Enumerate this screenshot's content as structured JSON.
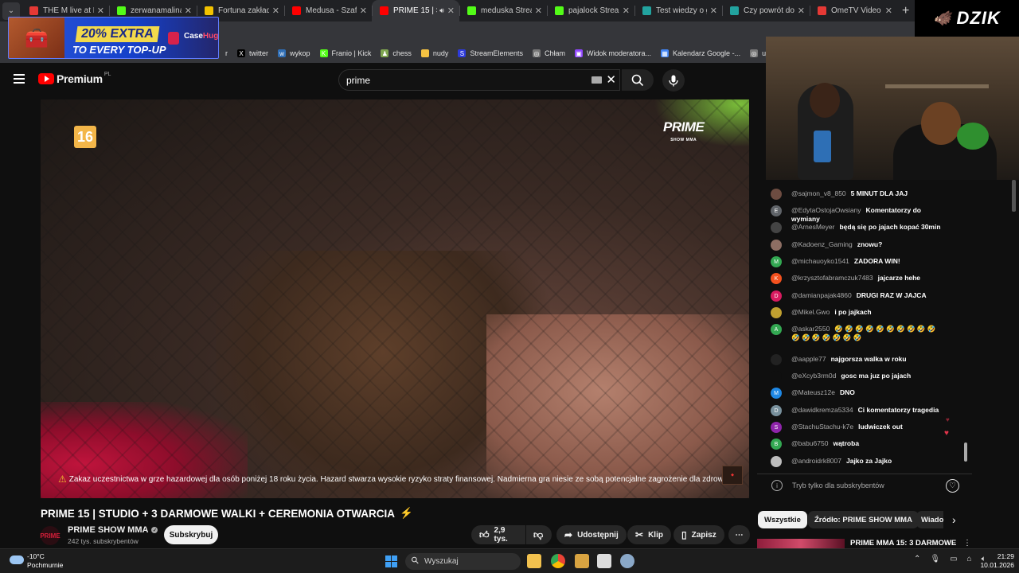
{
  "browser": {
    "tabs": [
      {
        "title": "THE M live at FESTI",
        "color": "#e53935",
        "active": false
      },
      {
        "title": "zerwanamalina Str",
        "color": "#53fc18",
        "active": false
      },
      {
        "title": "Fortuna zakłady b",
        "color": "#f2c200",
        "active": false
      },
      {
        "title": "Medusa - Szafa (p",
        "color": "#ff0000",
        "active": false
      },
      {
        "title": "PRIME 15 | STU",
        "color": "#ff0000",
        "active": true
      },
      {
        "title": "meduska Strea",
        "color": "#53fc18",
        "active": false
      },
      {
        "title": "pajalock Stream -",
        "color": "#53fc18",
        "active": false
      },
      {
        "title": "Test wiedzy o gru",
        "color": "#22a39f",
        "active": false
      },
      {
        "title": "Czy powrót do sz",
        "color": "#22a39f",
        "active": false
      },
      {
        "title": "OmeTV Video Ch",
        "color": "#e53935",
        "active": false
      }
    ],
    "bookmarks": [
      {
        "label": "r",
        "icon": "",
        "color": "#35363a"
      },
      {
        "label": "twitter",
        "icon": "X",
        "color": "#000000"
      },
      {
        "label": "wykop",
        "icon": "w",
        "color": "#2f6eb5"
      },
      {
        "label": "Franio | Kick",
        "icon": "K",
        "color": "#53fc18"
      },
      {
        "label": "chess",
        "icon": "♟",
        "color": "#7fa650"
      },
      {
        "label": "nudy",
        "icon": "",
        "color": "#f5c242"
      },
      {
        "label": "StreamElements",
        "icon": "S",
        "color": "#2e3bdb"
      },
      {
        "label": "Chłam",
        "icon": "◎",
        "color": "#777777"
      },
      {
        "label": "Widok moderatora...",
        "icon": "▣",
        "color": "#9146ff"
      },
      {
        "label": "Kalendarz Google -...",
        "icon": "▦",
        "color": "#4285f4"
      },
      {
        "label": "ujeb link",
        "icon": "◎",
        "color": "#777777"
      },
      {
        "label": "be",
        "icon": "▬",
        "color": "#e53935"
      }
    ]
  },
  "overlay": {
    "ad_line1": "20% EXTRA",
    "ad_line2": "TO EVERY TOP-UP",
    "ad_brand_a": "Case",
    "ad_brand_b": "Hug",
    "dzik": "DZIK"
  },
  "header": {
    "logo_text": "Premium",
    "logo_region": "PL",
    "search_value": "prime"
  },
  "video": {
    "age_rating": "16",
    "channel_logo_main": "PRIME",
    "channel_logo_sub": "SHOW MMA",
    "warning": "Zakaz uczestnictwa w grze hazardowej dla osób poniżej 18 roku życia. Hazard stwarza wysokie ryzyko straty finansowej. Nadmierna gra niesie ze sobą potencjalne zagrożenie dla zdrowia",
    "title": "PRIME 15 | STUDIO + 3 DARMOWE WALKI + CEREMONIA OTWARCIA",
    "channel": "PRIME SHOW MMA",
    "subscribers": "242 tys. subskrybentów",
    "subscribe_label": "Subskrybuj",
    "likes": "2,9 tys.",
    "share_label": "Udostępnij",
    "clip_label": "Klip",
    "save_label": "Zapisz"
  },
  "chat": {
    "messages": [
      {
        "author": "@sajmon_v8_850",
        "text": "5 MINUT DLA JAJ",
        "initial": "",
        "color": "#6d4c41"
      },
      {
        "author": "@EdytaOstojaOwsiany",
        "text": "Komentatorzy do wymiany",
        "initial": "E",
        "color": "#5f6368"
      },
      {
        "author": "@ArnesMeyer",
        "text": "będą się po jajach kopać 30min",
        "initial": "",
        "color": "#444444"
      },
      {
        "author": "@Kadoenz_Gaming",
        "text": "znowu?",
        "initial": "",
        "color": "#8d6e63"
      },
      {
        "author": "@michauoyko1541",
        "text": "ZADORA WIN!",
        "initial": "M",
        "color": "#33a852"
      },
      {
        "author": "@krzysztofabramczuk7483",
        "text": "jajcarze hehe",
        "initial": "K",
        "color": "#f4511e"
      },
      {
        "author": "@damianpajak4860",
        "text": "DRUGI RAZ W JAJCA",
        "initial": "D",
        "color": "#d81b60"
      },
      {
        "author": "@Mikel.Gwo",
        "text": "i po jajkach",
        "initial": "",
        "color": "#c0a030"
      },
      {
        "author": "@askar2550",
        "text": "🤣 🤣 🤣 🤣 🤣 🤣 🤣 🤣 🤣 🤣 🤣 🤣 🤣 🤣 🤣 🤣 🤣",
        "initial": "A",
        "color": "#33a852"
      },
      {
        "author": "@aapple77",
        "text": "najgorsza walka w roku",
        "initial": "",
        "color": "#222222"
      },
      {
        "author": "@eXcyb3rm0d",
        "text": "gosc ma juz po jajach",
        "initial": "",
        "color": "#0f0f0f"
      },
      {
        "author": "@Mateusz12e",
        "text": "DNO",
        "initial": "M",
        "color": "#1e88e5"
      },
      {
        "author": "@dawidkremza5334",
        "text": "Ci komentatorzy tragedia",
        "initial": "D",
        "color": "#78909c"
      },
      {
        "author": "@StachuStachu-k7e",
        "text": "ludwiczek out",
        "initial": "S",
        "color": "#8e24aa"
      },
      {
        "author": "@babu6750",
        "text": "wątroba",
        "initial": "B",
        "color": "#33a852"
      },
      {
        "author": "@androidrk8007",
        "text": "Jajko za Jajko",
        "initial": "",
        "color": "#bdbdbd"
      }
    ],
    "input_placeholder": "Tryb tylko dla subskrybentów"
  },
  "chips": [
    {
      "label": "Wszystkie",
      "active": true
    },
    {
      "label": "Źródło: PRIME SHOW MMA",
      "active": false
    },
    {
      "label": "Wiado",
      "active": false
    }
  ],
  "recommended": {
    "title": "PRIME MMA 15: 3 DARMOWE"
  },
  "taskbar": {
    "temperature": "-10°C",
    "weather": "Pochmurnie",
    "search_placeholder": "Wyszukaj",
    "time": "21:29",
    "date": "10.01.2026"
  }
}
